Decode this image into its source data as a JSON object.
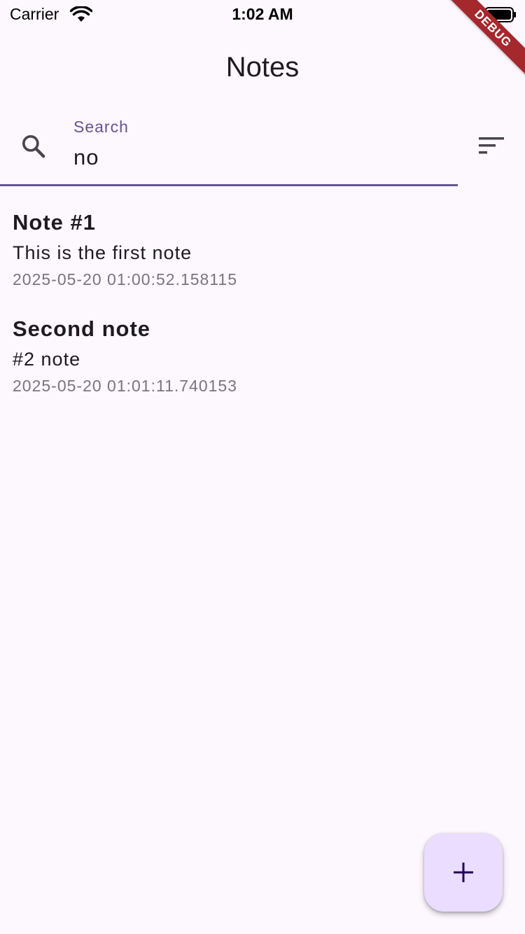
{
  "status_bar": {
    "carrier": "Carrier",
    "time": "1:02 AM"
  },
  "debug_banner": "DEBUG",
  "app_bar": {
    "title": "Notes"
  },
  "search": {
    "label": "Search",
    "value": "no"
  },
  "notes": [
    {
      "title": "Note #1",
      "body": "This is the first note",
      "date": "2025-05-20 01:00:52.158115"
    },
    {
      "title": "Second note",
      "body": "#2 note",
      "date": "2025-05-20 01:01:11.740153"
    }
  ],
  "icons": {
    "search": "search-icon",
    "sort": "sort-icon",
    "add": "plus-icon"
  },
  "colors": {
    "background": "#fdf7fe",
    "primary": "#65558f",
    "fab": "#eaddff",
    "debug": "#a5282c"
  }
}
